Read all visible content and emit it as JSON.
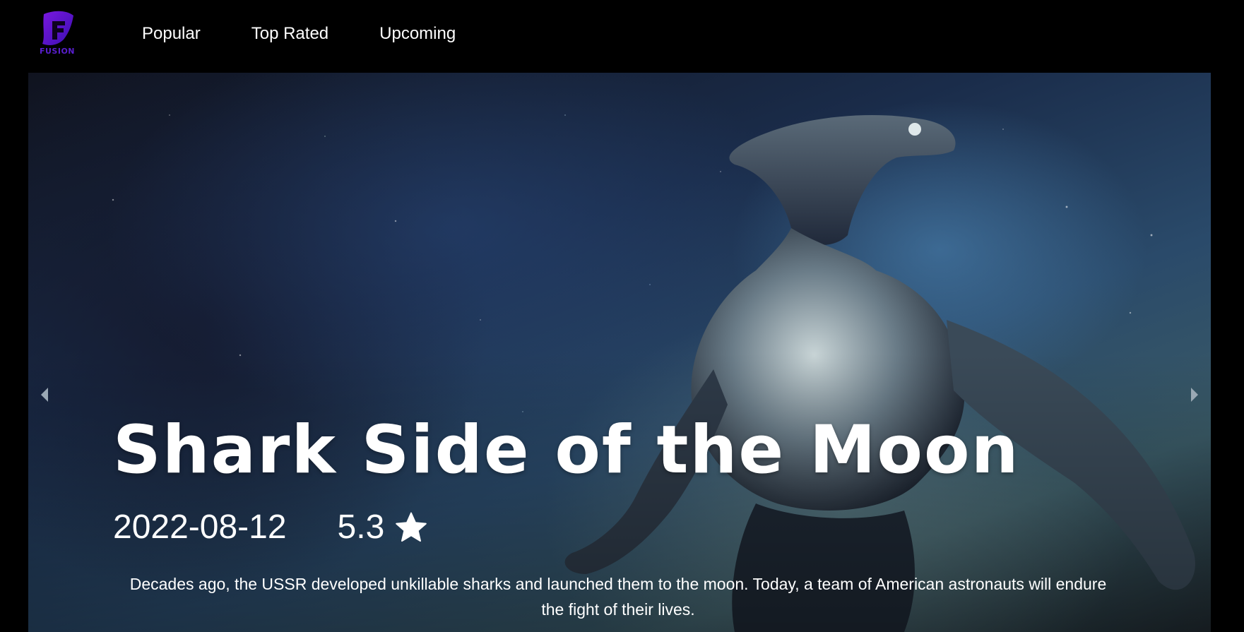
{
  "app": {
    "logo_text": "FUSION",
    "brand_color": "#6a1be0"
  },
  "nav": {
    "items": [
      {
        "label": "Popular"
      },
      {
        "label": "Top Rated"
      },
      {
        "label": "Upcoming"
      }
    ]
  },
  "hero": {
    "title": "Shark Side of the Moon",
    "release_date": "2022-08-12",
    "rating": "5.3",
    "rating_icon": "star-icon",
    "overview": "Decades ago, the USSR developed unkillable sharks and launched them to the moon. Today, a team of American astronauts will endure the fight of their lives.",
    "prev_icon": "chevron-left-icon",
    "next_icon": "chevron-right-icon"
  }
}
